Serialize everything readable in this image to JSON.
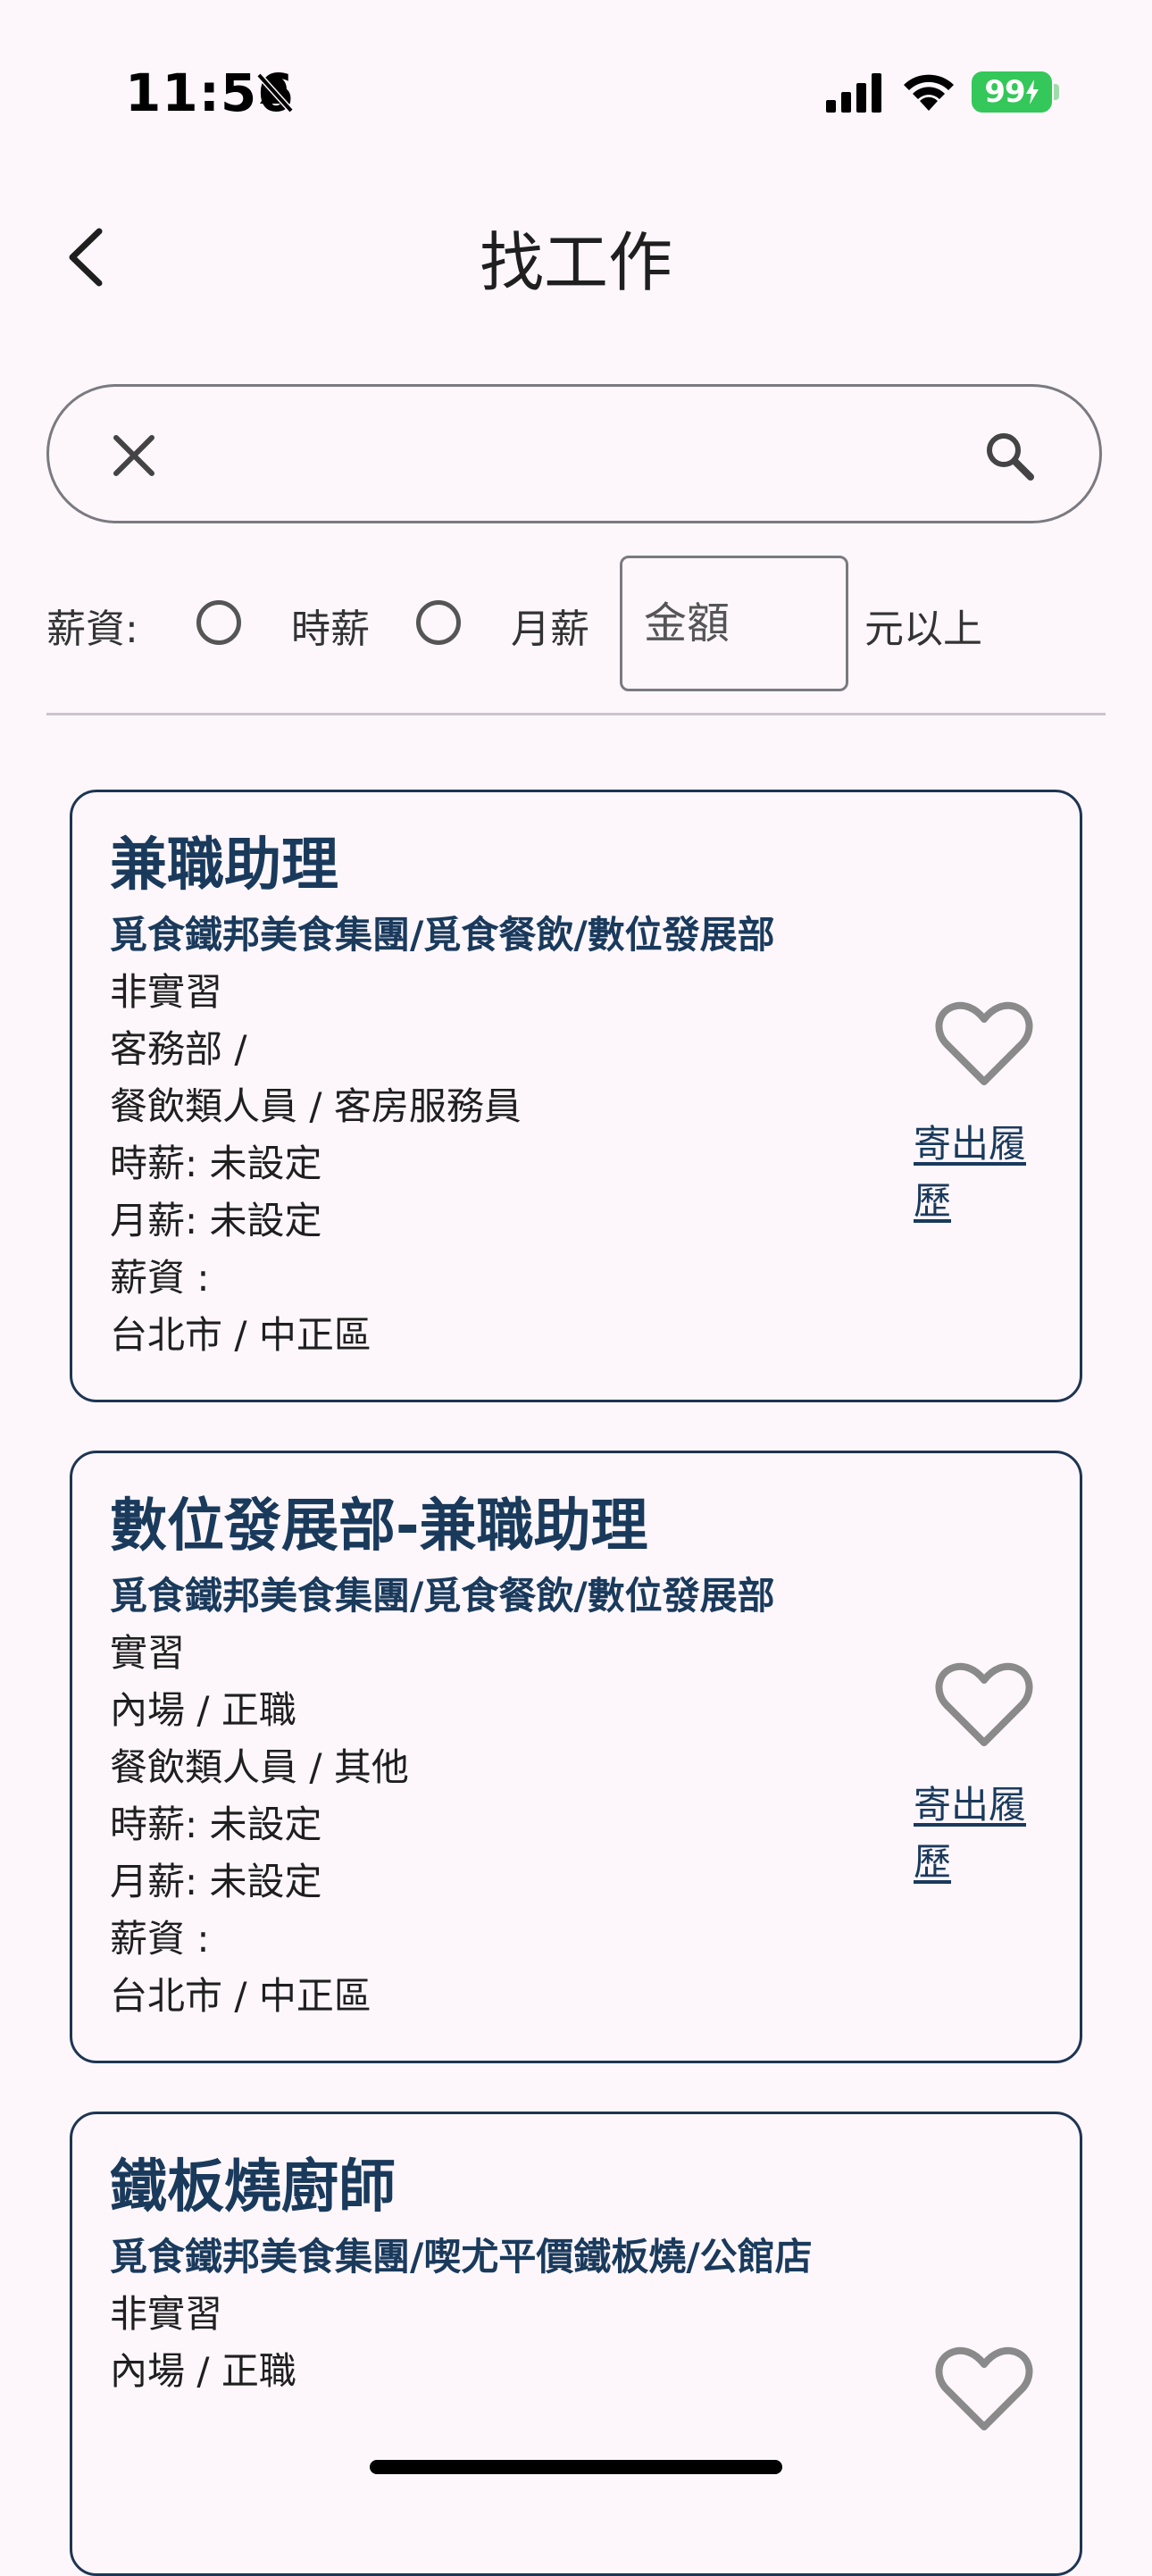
{
  "status_bar": {
    "time": "11:56",
    "battery": "99"
  },
  "header": {
    "title": "找工作"
  },
  "search": {
    "value": "",
    "placeholder": ""
  },
  "filter": {
    "salary_label": "薪資:",
    "hourly_label": "時薪",
    "monthly_label": "月薪",
    "amount_placeholder": "金額",
    "amount_suffix": "元以上"
  },
  "jobs": [
    {
      "title": "兼職助理",
      "company": "覓食鐵邦美食集團/覓食餐飲/數位發展部",
      "internship": "非實習",
      "department": "客務部 /",
      "category": "餐飲類人員 / 客房服務員",
      "hourly": "時薪: 未設定",
      "monthly": "月薪: 未設定",
      "salary": "薪資 :",
      "location": "台北市 / 中正區",
      "send_resume": "寄出履歷"
    },
    {
      "title": "數位發展部-兼職助理",
      "company": "覓食鐵邦美食集團/覓食餐飲/數位發展部",
      "internship": "實習",
      "department": "內場 / 正職",
      "category": "餐飲類人員 / 其他",
      "hourly": "時薪: 未設定",
      "monthly": "月薪: 未設定",
      "salary": "薪資 :",
      "location": "台北市 / 中正區",
      "send_resume": "寄出履歷"
    },
    {
      "title": "鐵板燒廚師",
      "company": "覓食鐵邦美食集團/喫尤平價鐵板燒/公館店",
      "internship": "非實習",
      "department": "內場 / 正職"
    }
  ],
  "icons": {
    "back": "chevron-left-icon",
    "clear": "close-icon",
    "search": "search-icon",
    "favorite": "heart-outline-icon"
  },
  "colors": {
    "background": "#fdf7fc",
    "accent": "#1a3a5c",
    "card_border": "#1e3553",
    "battery": "#34c759"
  }
}
